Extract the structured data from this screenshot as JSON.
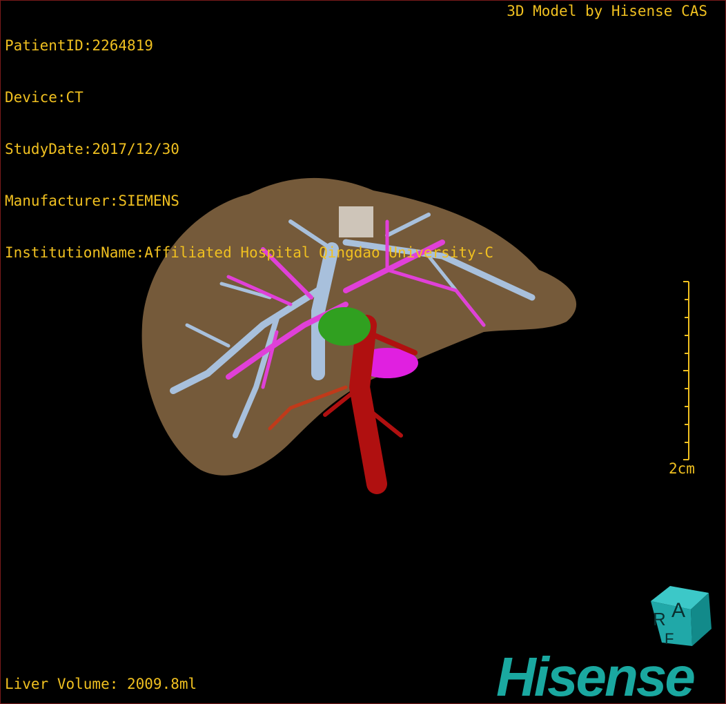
{
  "info": {
    "patient_id": "PatientID:2264819",
    "device": "Device:CT",
    "study_date": "StudyDate:2017/12/30",
    "manufacturer": "Manufacturer:SIEMENS",
    "institution": "InstitutionName:Affiliated Hospital Qingdao University-C"
  },
  "credit": "3D Model by Hisense CAS",
  "scale_bar": {
    "label": "2cm"
  },
  "liver_volume": "Liver Volume: 2009.8ml",
  "orientation_cube": {
    "faces": [
      "R",
      "A",
      "F"
    ]
  },
  "logo": "Hisense",
  "colors": {
    "text": "#f0c020",
    "liver": "#8a6a44",
    "hepatic_vein": "#a8c0dc",
    "portal_vein": "#e040d8",
    "artery": "#b01010",
    "tumor": "#30a020",
    "logo": "#1aa8a0"
  }
}
